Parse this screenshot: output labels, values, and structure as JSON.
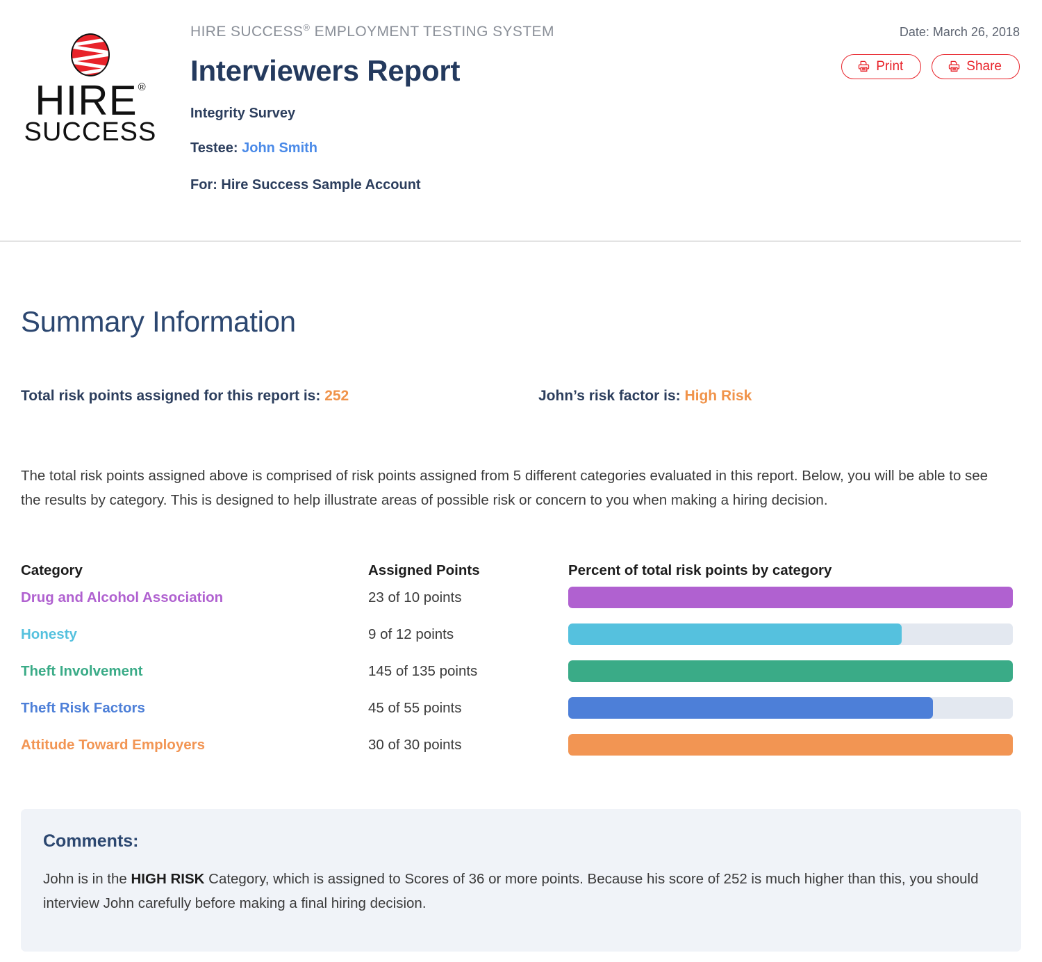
{
  "header": {
    "system_line_prefix": "HIRE SUCCESS",
    "system_line_sup": "®",
    "system_line_suffix": " EMPLOYMENT TESTING SYSTEM",
    "report_title": "Interviewers Report",
    "survey_name": "Integrity Survey",
    "testee_label": "Testee:",
    "testee_name": "John Smith",
    "for_line": "For: Hire Success Sample Account",
    "date_line": "Date: March 26, 2018",
    "print_label": "Print",
    "share_label": "Share",
    "logo": {
      "wordmark": "HIRE",
      "wordmark_sup": "®",
      "subword": "SUCCESS"
    }
  },
  "summary": {
    "section_title": "Summary Information",
    "total_points_label": "Total risk points assigned for this report is:",
    "total_points_value": "252",
    "risk_factor_label": "John’s risk factor is:",
    "risk_factor_value": "High Risk",
    "intro_paragraph": "The total risk points assigned above is comprised of risk points assigned from 5 different categories evaluated in this report. Below, you will be able to see the results by category. This is designed to help illustrate areas of possible risk or concern to you when making a hiring decision."
  },
  "chart_data": {
    "type": "bar",
    "title": "Percent of total risk points by category",
    "orientation": "horizontal",
    "grid": false,
    "legend": "none",
    "xlabel": "",
    "ylabel": "",
    "xlim": [
      0,
      100
    ],
    "columns": [
      "Category",
      "Assigned Points",
      "Percent of total risk points by category"
    ],
    "categories": [
      "Drug and Alcohol Association",
      "Honesty",
      "Theft Involvement",
      "Theft Risk Factors",
      "Attitude Toward Employers"
    ],
    "assigned": [
      23,
      9,
      145,
      45,
      30
    ],
    "maximums": [
      10,
      12,
      135,
      55,
      30
    ],
    "points_text": [
      "23 of 10 points",
      "9 of 12 points",
      "145 of 135 points",
      "45 of 55 points",
      "30 of 30 points"
    ],
    "values": [
      100,
      75,
      100,
      82,
      100
    ],
    "colors": [
      "#b061d0",
      "#55c1de",
      "#3aab87",
      "#4d7fd8",
      "#f29553"
    ],
    "track_color": "#e3e8f0"
  },
  "comments": {
    "title": "Comments:",
    "text_before": "John is in the ",
    "emphasis": "HIGH RISK",
    "text_after": " Category, which is assigned to Scores of 36 or more points. Because his score of 252 is much higher than this, you should interview John carefully before making a final hiring decision."
  },
  "theme": {
    "brand_red": "#e8232a",
    "navy": "#2c3e5d",
    "heading_navy": "#2c4770",
    "accent_orange": "#f0934a",
    "link_blue": "#4a8ae8",
    "comment_bg": "#f0f3f8"
  }
}
